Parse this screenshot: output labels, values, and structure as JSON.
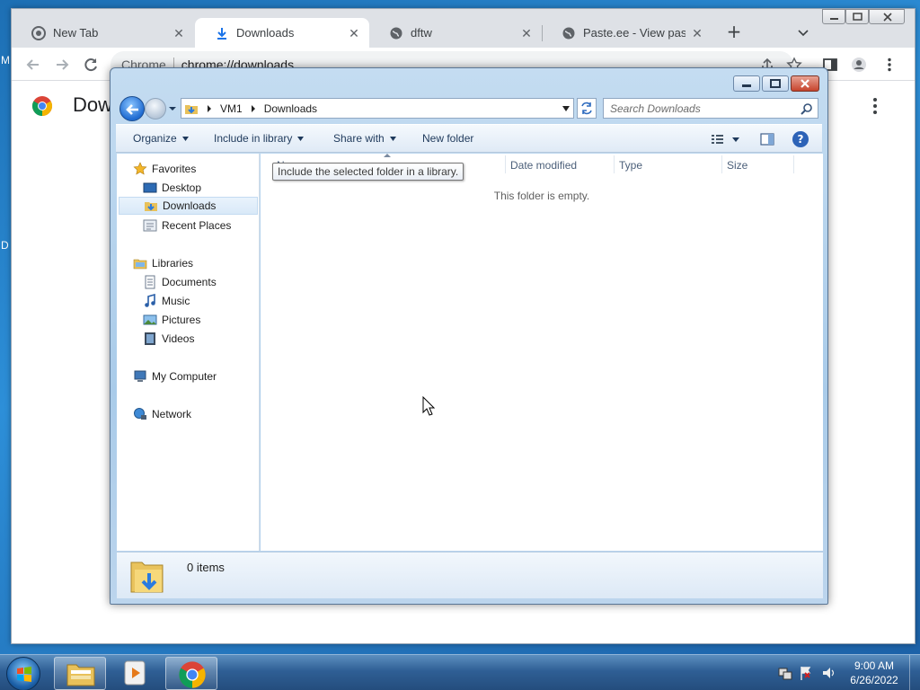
{
  "desktop": {
    "edge_top": "M",
    "edge_mid": "D"
  },
  "chrome": {
    "tabs": [
      {
        "label": "New Tab",
        "icon": "chrome-icon"
      },
      {
        "label": "Downloads",
        "icon": "download-icon"
      },
      {
        "label": "dftw",
        "icon": "globe-icon"
      },
      {
        "label": "Paste.ee - View paste Ro",
        "icon": "globe-icon"
      }
    ],
    "omnibox": {
      "origin": "Chrome",
      "url": "chrome://downloads"
    },
    "page_title": "Dow"
  },
  "explorer": {
    "breadcrumb": [
      "VM1",
      "Downloads"
    ],
    "search_placeholder": "Search Downloads",
    "commands": {
      "organize": "Organize",
      "include_in_library": "Include in library",
      "share_with": "Share with",
      "new_folder": "New folder"
    },
    "nav": {
      "favorites": "Favorites",
      "desktop": "Desktop",
      "downloads": "Downloads",
      "recent_places": "Recent Places",
      "libraries": "Libraries",
      "documents": "Documents",
      "music": "Music",
      "pictures": "Pictures",
      "videos": "Videos",
      "my_computer": "My Computer",
      "network": "Network"
    },
    "columns": {
      "name": "Name",
      "date_modified": "Date modified",
      "type": "Type",
      "size": "Size"
    },
    "empty_message": "This folder is empty.",
    "tooltip": "Include the selected folder in a library.",
    "item_count": "0 items"
  },
  "taskbar": {
    "time": "9:00 AM",
    "date": "6/26/2022"
  },
  "colors": {
    "chrome_tabstrip": "#dee1e6",
    "explorer_frame": "#a9cbe9",
    "taskbar": "#2f5f95",
    "close_red": "#c6432c"
  }
}
